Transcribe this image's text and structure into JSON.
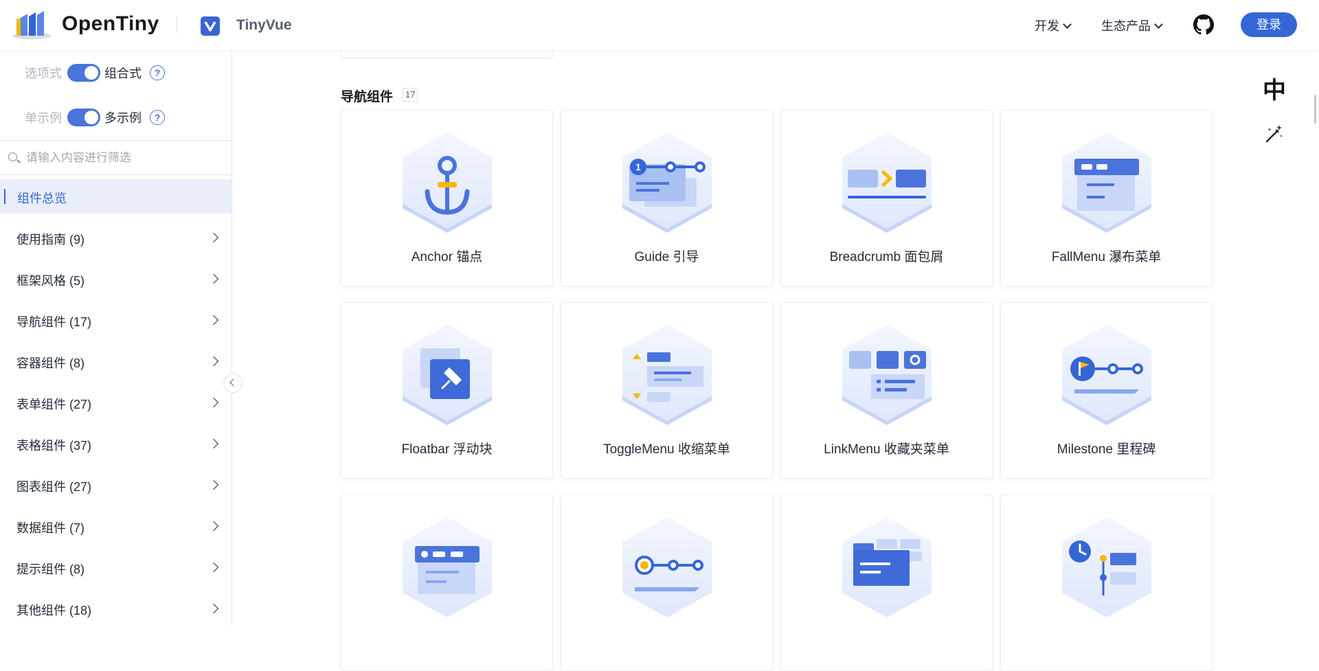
{
  "header": {
    "brand": "OpenTiny",
    "product": "TinyVue",
    "menus": [
      {
        "label": "开发"
      },
      {
        "label": "生态产品"
      }
    ],
    "login": "登录"
  },
  "sidebar": {
    "api_toggle": {
      "off": "选项式",
      "on": "组合式"
    },
    "demo_toggle": {
      "off": "单示例",
      "on": "多示例"
    },
    "search_placeholder": "请输入内容进行筛选",
    "active": "组件总览",
    "items": [
      {
        "label": "使用指南 (9)"
      },
      {
        "label": "框架风格 (5)"
      },
      {
        "label": "导航组件 (17)"
      },
      {
        "label": "容器组件 (8)"
      },
      {
        "label": "表单组件 (27)"
      },
      {
        "label": "表格组件 (37)"
      },
      {
        "label": "图表组件 (27)"
      },
      {
        "label": "数据组件 (7)"
      },
      {
        "label": "提示组件 (8)"
      },
      {
        "label": "其他组件 (18)"
      }
    ]
  },
  "main": {
    "section_title": "导航组件",
    "section_count": "17",
    "cards": [
      {
        "label": "Anchor 锚点",
        "icon": "anchor-icon"
      },
      {
        "label": "Guide 引导",
        "icon": "guide-icon"
      },
      {
        "label": "Breadcrumb 面包屑",
        "icon": "breadcrumb-icon"
      },
      {
        "label": "FallMenu 瀑布菜单",
        "icon": "fallmenu-icon"
      },
      {
        "label": "Floatbar 浮动块",
        "icon": "floatbar-icon"
      },
      {
        "label": "ToggleMenu 收缩菜单",
        "icon": "togglemenu-icon"
      },
      {
        "label": "LinkMenu 收藏夹菜单",
        "icon": "linkmenu-icon"
      },
      {
        "label": "Milestone 里程碑",
        "icon": "milestone-icon"
      },
      {
        "label": "",
        "icon": "navmenu-icon"
      },
      {
        "label": "",
        "icon": "steps-icon"
      },
      {
        "label": "",
        "icon": "tabs-icon"
      },
      {
        "label": "",
        "icon": "timeline-icon"
      }
    ]
  },
  "right_tools": {
    "language": "中"
  },
  "colors": {
    "primary": "#3466d6",
    "icon_blue": "#4a73dc",
    "active_bg": "#eaeefb"
  }
}
